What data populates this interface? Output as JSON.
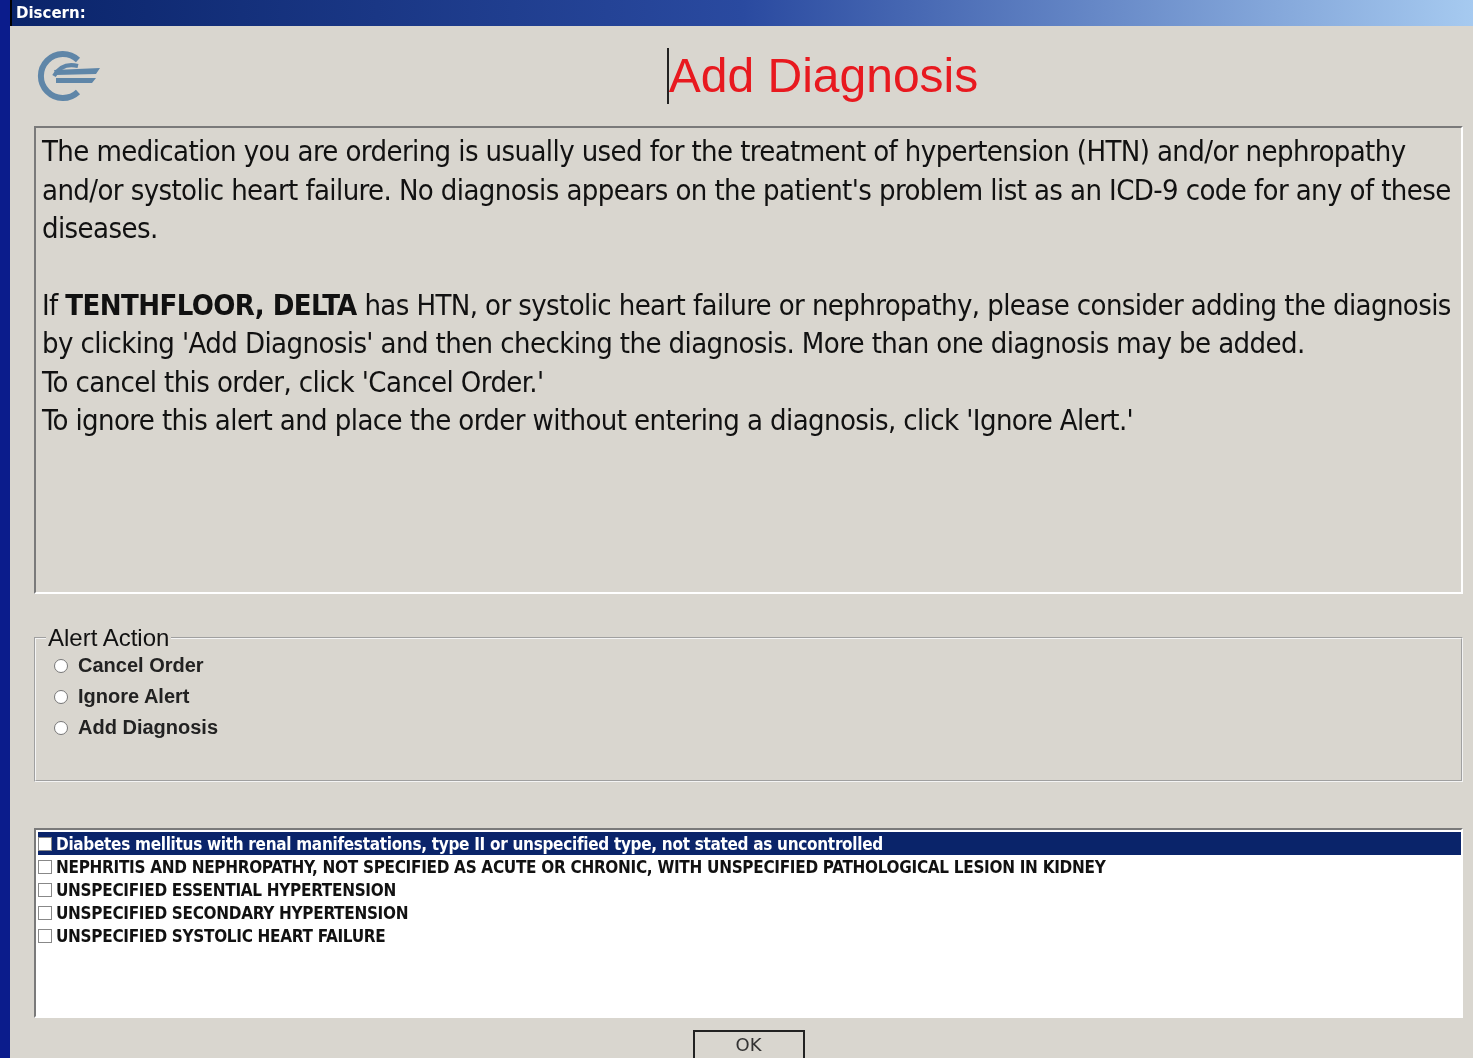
{
  "window": {
    "title": "Discern:"
  },
  "header": {
    "title": "Add Diagnosis"
  },
  "message": {
    "paragraphs": [
      "The medication you are ordering is usually used for the treatment of hypertension (HTN) and/or nephropathy and/or systolic heart failure. No diagnosis appears on the patient's problem list as an ICD-9 code for any of these diseases.",
      "If **TENTHFLOOR, DELTA** has HTN, or systolic heart failure or nephropathy, please consider adding the diagnosis by clicking 'Add Diagnosis' and then checking the diagnosis. More than one diagnosis may be added.",
      "To cancel this order, click 'Cancel Order.'",
      "To ignore this alert and place the order without entering a diagnosis, click 'Ignore Alert.'"
    ]
  },
  "alert_action": {
    "legend": "Alert Action",
    "options": [
      {
        "label": "Cancel Order",
        "selected": false
      },
      {
        "label": "Ignore Alert",
        "selected": false
      },
      {
        "label": "Add Diagnosis",
        "selected": false
      }
    ]
  },
  "diagnoses": [
    {
      "label": "Diabetes mellitus with renal manifestations, type II or unspecified type, not stated as uncontrolled",
      "checked": false,
      "selected": true
    },
    {
      "label": "NEPHRITIS AND NEPHROPATHY, NOT SPECIFIED AS ACUTE OR CHRONIC, WITH UNSPECIFIED PATHOLOGICAL LESION IN KIDNEY",
      "checked": false,
      "selected": false
    },
    {
      "label": "UNSPECIFIED ESSENTIAL HYPERTENSION",
      "checked": false,
      "selected": false
    },
    {
      "label": "UNSPECIFIED SECONDARY HYPERTENSION",
      "checked": false,
      "selected": false
    },
    {
      "label": "UNSPECIFIED SYSTOLIC HEART FAILURE",
      "checked": false,
      "selected": false
    }
  ],
  "buttons": [
    "OK"
  ]
}
